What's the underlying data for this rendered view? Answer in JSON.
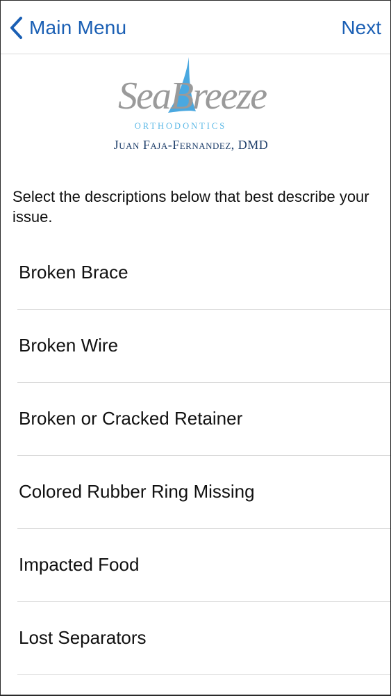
{
  "navbar": {
    "back_label": "Main Menu",
    "next_label": "Next",
    "accent_color": "#1a5fb4"
  },
  "logo": {
    "wordmark": "SeaBreeze",
    "subtitle": "ORTHODONTICS",
    "doctor": "Juan Faja-Fernandez, DMD"
  },
  "instruction": "Select the descriptions below that best describe your issue.",
  "issues": [
    {
      "label": "Broken Brace"
    },
    {
      "label": "Broken Wire"
    },
    {
      "label": "Broken or Cracked Retainer"
    },
    {
      "label": "Colored Rubber Ring Missing"
    },
    {
      "label": "Impacted Food"
    },
    {
      "label": "Lost Separators"
    }
  ]
}
